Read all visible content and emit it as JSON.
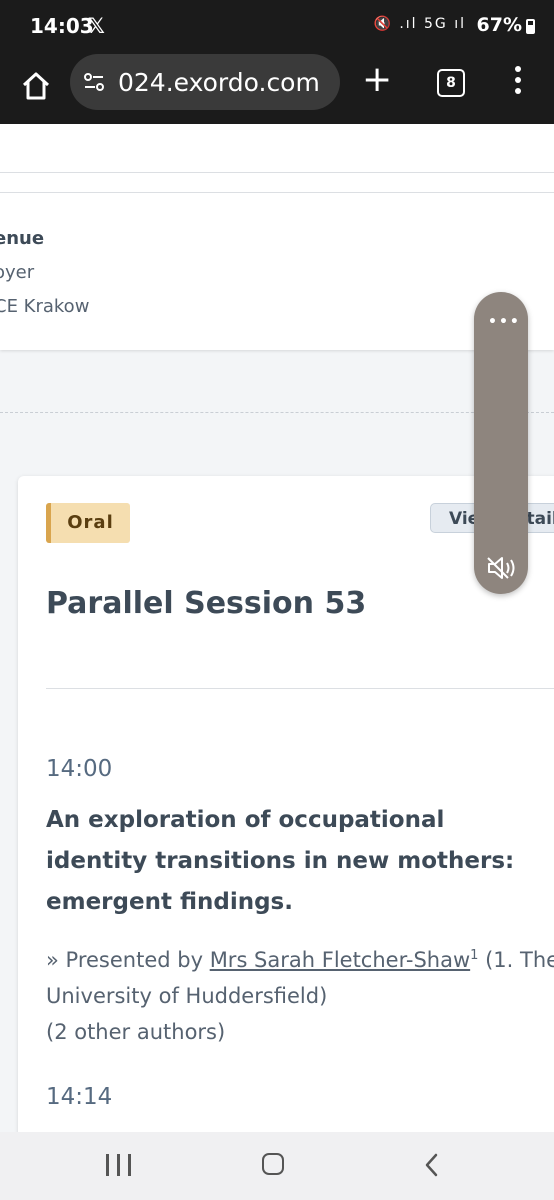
{
  "status_bar": {
    "time": "14:03",
    "x_app": "𝕏",
    "signal_icons": "🔇 .ıl 5G ıl",
    "battery": "67%"
  },
  "browser": {
    "url": "024.exordo.com",
    "tab_count": "8"
  },
  "venue": {
    "label": "enue",
    "room": "oyer",
    "place": "CE Krakow"
  },
  "session": {
    "badge": "Oral",
    "view_details": "View Details",
    "title": "Parallel Session 53",
    "talk1": {
      "time": "14:00",
      "title": "An exploration of occupational identity transitions in new mothers: emergent findings.",
      "presented_prefix": "» Presented by ",
      "presenter": "Mrs Sarah Fletcher-Shaw",
      "affiliation_index": "1",
      "affiliation": " (1. The University of Huddersfield)",
      "other_authors": "(2 other authors)"
    },
    "talk2": {
      "time": "14:14"
    }
  },
  "float_control": {
    "menu": "•••"
  }
}
